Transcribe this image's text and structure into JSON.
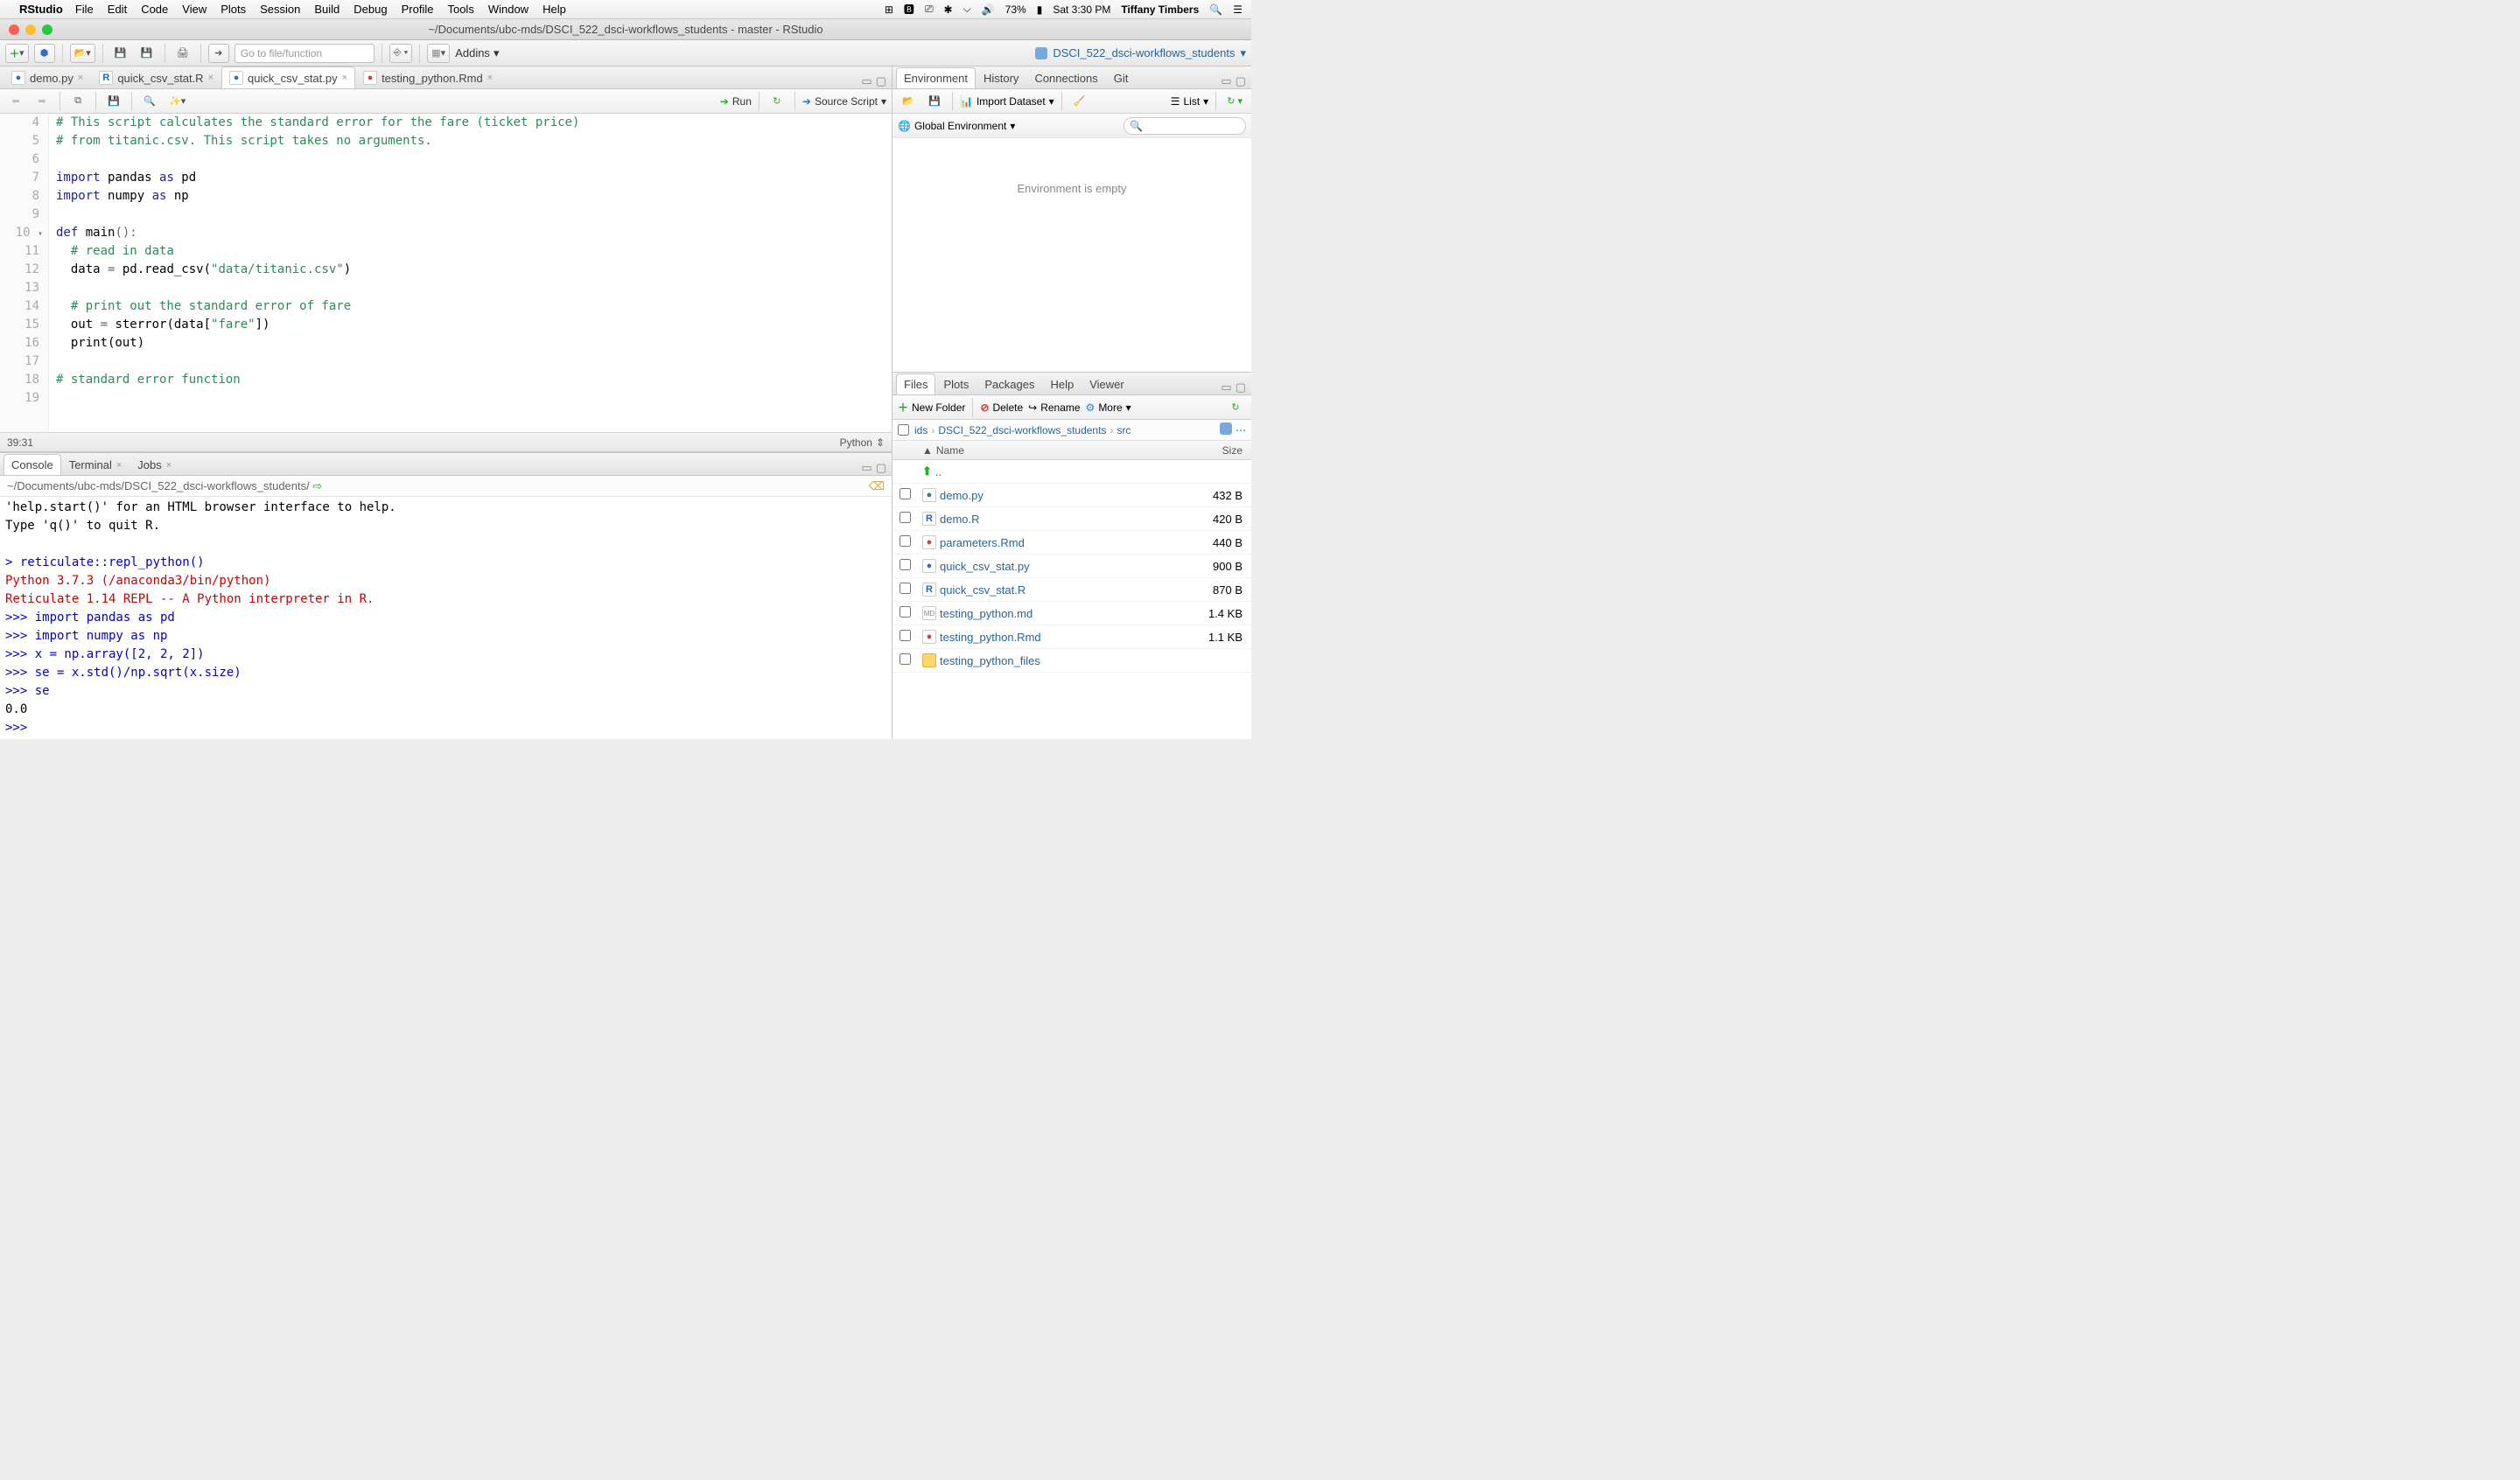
{
  "menubar": {
    "appname": "RStudio",
    "items": [
      "File",
      "Edit",
      "Code",
      "View",
      "Plots",
      "Session",
      "Build",
      "Debug",
      "Profile",
      "Tools",
      "Window",
      "Help"
    ],
    "battery": "73%",
    "datetime": "Sat 3:30 PM",
    "user": "Tiffany Timbers"
  },
  "window": {
    "title": "~/Documents/ubc-mds/DSCI_522_dsci-workflows_students - master - RStudio",
    "project": "DSCI_522_dsci-workflows_students"
  },
  "toolbar": {
    "goto_placeholder": "Go to file/function",
    "addins": "Addins"
  },
  "source": {
    "tabs": [
      {
        "label": "demo.py"
      },
      {
        "label": "quick_csv_stat.R"
      },
      {
        "label": "quick_csv_stat.py"
      },
      {
        "label": "testing_python.Rmd"
      }
    ],
    "active_tab": 2,
    "run": "Run",
    "source_script": "Source Script",
    "cursor": "39:31",
    "language": "Python",
    "lines": [
      {
        "n": 4,
        "html": "<span class=\"com\"># This script calculates the standard error for the fare (ticket price)</span>"
      },
      {
        "n": 5,
        "html": "<span class=\"com\"># from titanic.csv. This script takes no arguments.</span>"
      },
      {
        "n": 6,
        "html": ""
      },
      {
        "n": 7,
        "html": "<span class=\"kwi\">import</span> pandas <span class=\"kwi\">as</span> pd"
      },
      {
        "n": 8,
        "html": "<span class=\"kwi\">import</span> numpy <span class=\"kwi\">as</span> np"
      },
      {
        "n": 9,
        "html": ""
      },
      {
        "n": 10,
        "fold": true,
        "html": "<span class=\"kwi\">def</span> main<span class=\"op\">():</span>"
      },
      {
        "n": 11,
        "html": "  <span class=\"com\"># read in data</span>"
      },
      {
        "n": 12,
        "html": "  data <span class=\"op\">=</span> pd.read_csv(<span class=\"str\">\"data/titanic.csv\"</span>)"
      },
      {
        "n": 13,
        "html": ""
      },
      {
        "n": 14,
        "html": "  <span class=\"com\"># print out the standard error of fare</span>"
      },
      {
        "n": 15,
        "html": "  out <span class=\"op\">=</span> sterror(data[<span class=\"str\">\"fare\"</span>])"
      },
      {
        "n": 16,
        "html": "  print(out)"
      },
      {
        "n": 17,
        "html": ""
      },
      {
        "n": 18,
        "html": "<span class=\"com\"># standard error function</span>"
      },
      {
        "n": 19,
        "html": ""
      }
    ]
  },
  "console": {
    "tabs": [
      "Console",
      "Terminal",
      "Jobs"
    ],
    "path": "~/Documents/ubc-mds/DSCI_522_dsci-workflows_students/",
    "lines": [
      {
        "cls": "",
        "text": "'help.start()' for an HTML browser interface to help."
      },
      {
        "cls": "",
        "text": "Type 'q()' to quit R."
      },
      {
        "cls": "",
        "text": ""
      },
      {
        "cls": "cblue",
        "text": "> reticulate::repl_python()"
      },
      {
        "cls": "cred",
        "text": "Python 3.7.3 (/anaconda3/bin/python)"
      },
      {
        "cls": "cred",
        "text": "Reticulate 1.14 REPL -- A Python interpreter in R."
      },
      {
        "cls": "cblue",
        "text": ">>> import pandas as pd"
      },
      {
        "cls": "cblue",
        "text": ">>> import numpy as np"
      },
      {
        "cls": "cblue",
        "text": ">>> x = np.array([2, 2, 2])"
      },
      {
        "cls": "cblue",
        "text": ">>> se = x.std()/np.sqrt(x.size)"
      },
      {
        "cls": "cblue",
        "text": ">>> se"
      },
      {
        "cls": "",
        "text": "0.0"
      },
      {
        "cls": "cblue",
        "text": ">>> "
      }
    ]
  },
  "env": {
    "tabs": [
      "Environment",
      "History",
      "Connections",
      "Git"
    ],
    "import": "Import Dataset",
    "list": "List",
    "scope": "Global Environment",
    "empty": "Environment is empty"
  },
  "files": {
    "tabs": [
      "Files",
      "Plots",
      "Packages",
      "Help",
      "Viewer"
    ],
    "newfolder": "New Folder",
    "delete": "Delete",
    "rename": "Rename",
    "more": "More",
    "breadcrumb": [
      "ids",
      "DSCI_522_dsci-workflows_students",
      "src"
    ],
    "hdr_name": "Name",
    "hdr_size": "Size",
    "up": "..",
    "rows": [
      {
        "icon": "py",
        "name": "demo.py",
        "size": "432 B"
      },
      {
        "icon": "r",
        "name": "demo.R",
        "size": "420 B"
      },
      {
        "icon": "rmd",
        "name": "parameters.Rmd",
        "size": "440 B"
      },
      {
        "icon": "py",
        "name": "quick_csv_stat.py",
        "size": "900 B"
      },
      {
        "icon": "r",
        "name": "quick_csv_stat.R",
        "size": "870 B"
      },
      {
        "icon": "md",
        "name": "testing_python.md",
        "size": "1.4 KB"
      },
      {
        "icon": "rmd",
        "name": "testing_python.Rmd",
        "size": "1.1 KB"
      },
      {
        "icon": "folder",
        "name": "testing_python_files",
        "size": ""
      }
    ]
  }
}
